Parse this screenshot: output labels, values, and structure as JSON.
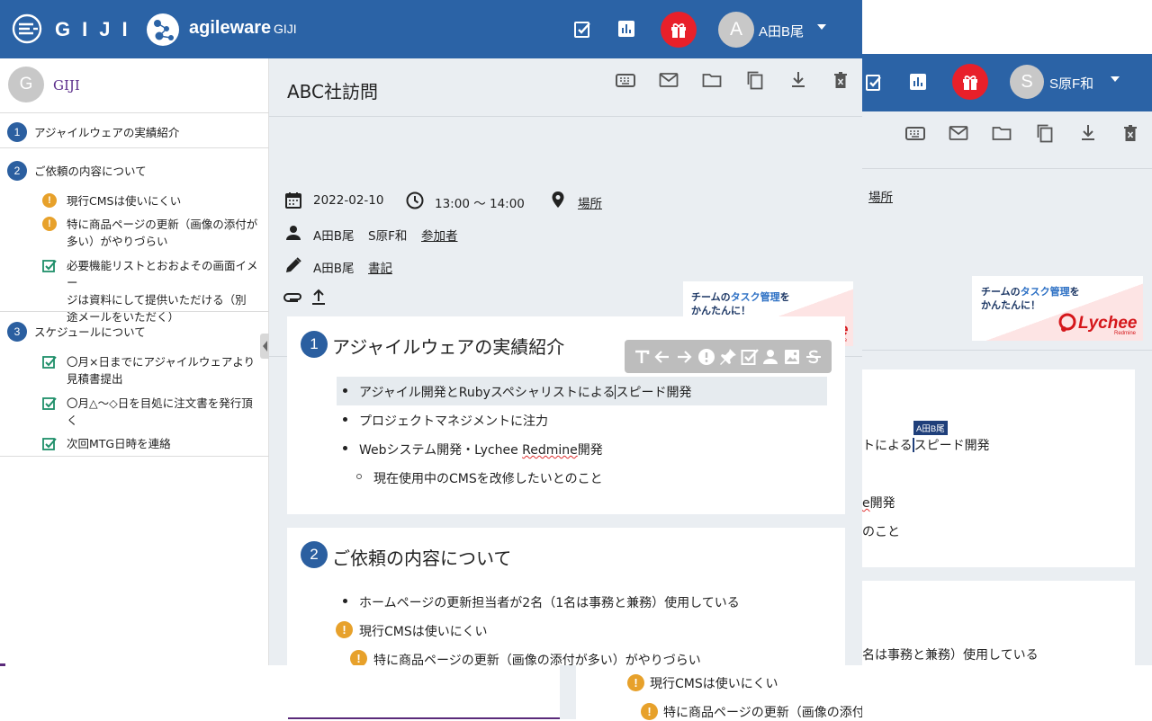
{
  "brand": {
    "wordmark": "GIJI",
    "company": "agileware",
    "app_name": "GIJI"
  },
  "front_user": {
    "initial": "A",
    "name": "A田B尾"
  },
  "back_user": {
    "initial": "S",
    "name": "S原F和"
  },
  "colors": {
    "header": "#2b63a6",
    "badge": "#2b5fa0",
    "warning": "#e7a12b",
    "check": "#1f8f6a",
    "gift": "#e8202a"
  },
  "sidebar": {
    "avatar_initial": "G",
    "title": "GIJI",
    "sections": [
      {
        "num": "1",
        "title": "アジャイルウェアの実績紹介",
        "items": []
      },
      {
        "num": "2",
        "title": "ご依頼の内容について",
        "items": [
          {
            "icon": "warning-icon",
            "lines": [
              "現行CMSは使いにくい"
            ]
          },
          {
            "icon": "warning-icon",
            "lines": [
              "特に商品ページの更新（画像の添付が",
              "多い）がやりづらい"
            ]
          },
          {
            "icon": "check-icon",
            "lines": [
              "必要機能リストとおおよその画面イメー",
              "ジは資料にして提供いただける（別",
              "途メールをいただく）"
            ]
          }
        ]
      },
      {
        "num": "3",
        "title": "スケジュールについて",
        "items": [
          {
            "icon": "check-icon",
            "lines": [
              "〇月×日までにアジャイルウェアより",
              "見積書提出"
            ]
          },
          {
            "icon": "check-icon",
            "lines": [
              "〇月△〜◇日を目処に注文書を発行頂",
              "く"
            ]
          },
          {
            "icon": "check-icon",
            "lines": [
              "次回MTG日時を連絡"
            ]
          }
        ]
      }
    ]
  },
  "meeting": {
    "title": "ABC社訪問",
    "date": "2022-02-10",
    "time": "13:00 〜 14:00",
    "location_link": "場所",
    "participants": [
      "A田B尾",
      "S原F和"
    ],
    "participants_link": "参加者",
    "writer": "A田B尾",
    "writer_link": "書記"
  },
  "ad": {
    "line1_pre": "チームの",
    "line1_highlight": "タスク管理",
    "line1_post": "を",
    "line2": "かんたんに！",
    "small": "- ライチレッドマイン -",
    "brand": "Lychee",
    "sub": "Redmine"
  },
  "content": {
    "section1": {
      "num": "1",
      "heading": "アジャイルウェアの実績紹介",
      "bullets": [
        {
          "text_a": "アジャイル開発とRubyスペシャリストによる",
          "text_b": "スピード開発"
        },
        {
          "text": "プロジェクトマネジメントに注力"
        },
        {
          "text_a": "Webシステム開発・Lychee ",
          "text_squiggle": "Redmine",
          "text_b": "開発"
        }
      ],
      "sub_bullet": "現在使用中のCMSを改修したいとのこと"
    },
    "section2": {
      "num": "2",
      "heading": "ご依頼の内容について",
      "bullet": "ホームページの更新担当者が2名（1名は事務と兼務）使用している",
      "warn1": "現行CMSは使いにくい",
      "warn2": "特に商品ページの更新（画像の添付が多い）がやりづらい"
    }
  },
  "back_content": {
    "location_link": "場所",
    "cursor_user": "A田B尾",
    "line1": "トによる",
    "line1b": "スピード開発",
    "line3a": "e",
    "line3b": "開発",
    "line4": "のこと",
    "sec2_bullet": "名は事務と兼務）使用している",
    "warn1": "現行CMSは使いにくい",
    "warn2": "特に商品ページの更新（画像の添付が多い）がやりづらい"
  },
  "toolbar_icons": [
    "keyboard-icon",
    "mail-icon",
    "folder-icon",
    "copy-icon",
    "download-icon",
    "delete-icon"
  ],
  "format_icons": [
    "text-icon",
    "arrow-left-icon",
    "arrow-right-icon",
    "alert-icon",
    "pin-icon",
    "checkbox-icon",
    "person-icon",
    "image-icon",
    "strikethrough-icon"
  ]
}
